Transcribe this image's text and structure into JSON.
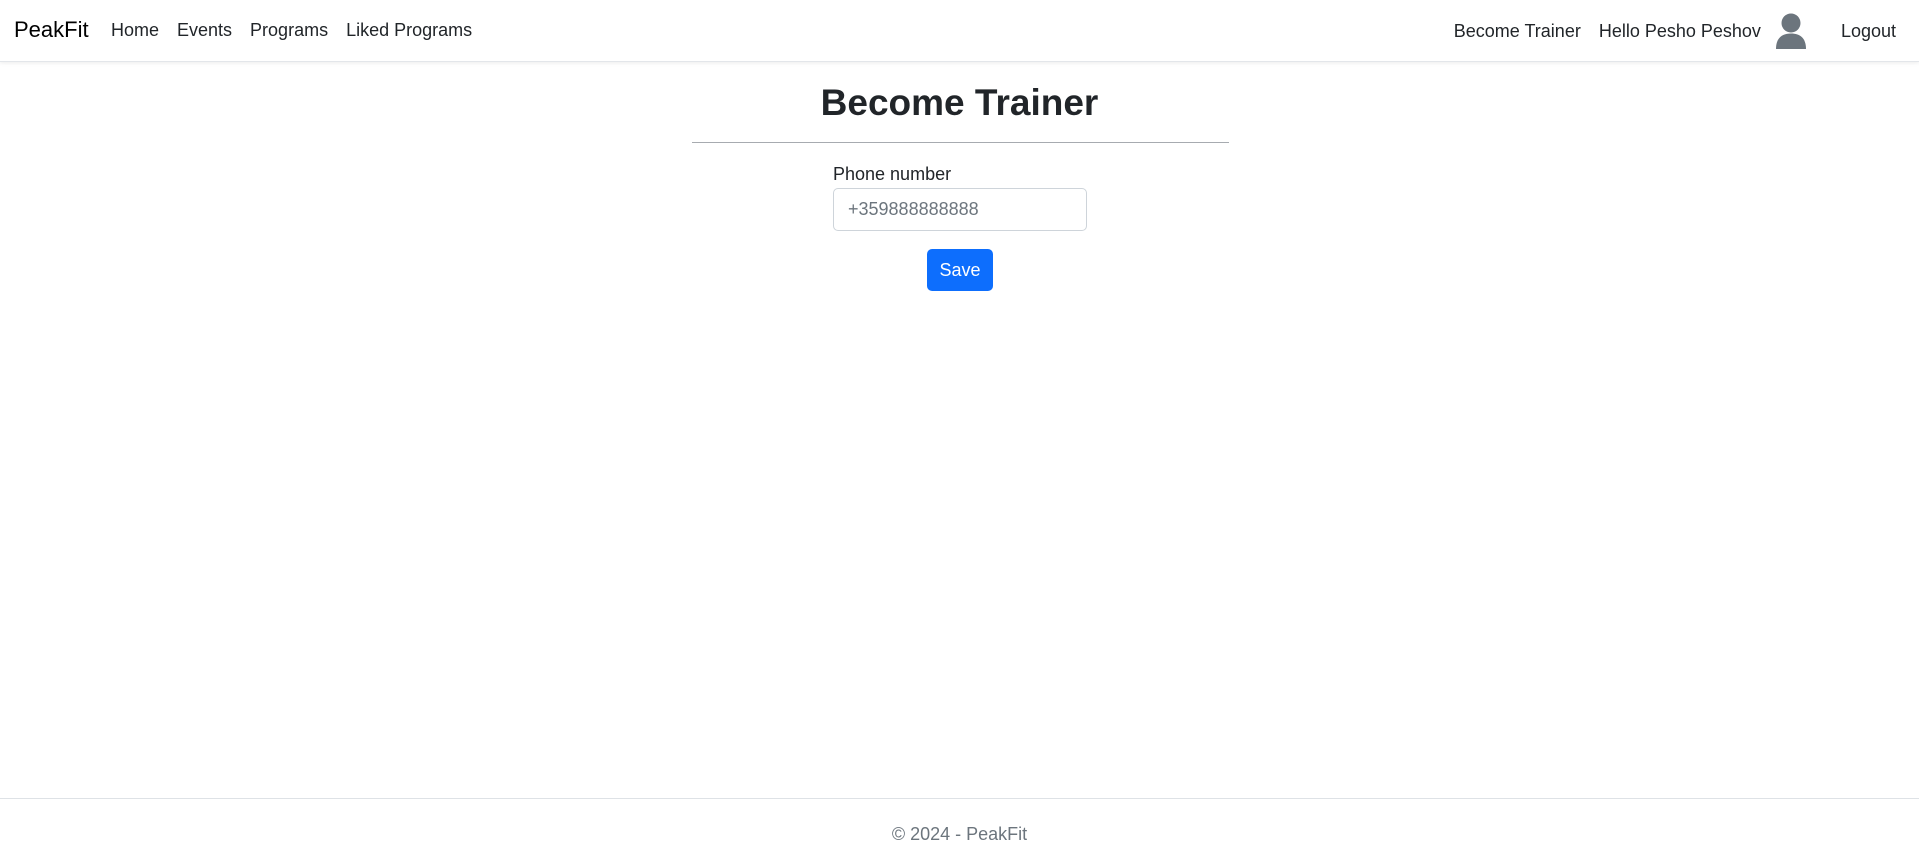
{
  "navbar": {
    "brand": "PeakFit",
    "links": [
      {
        "label": "Home"
      },
      {
        "label": "Events"
      },
      {
        "label": "Programs"
      },
      {
        "label": "Liked Programs"
      }
    ],
    "become_trainer": "Become Trainer",
    "greeting": "Hello Pesho Peshov",
    "avatar_icon": "user-avatar-icon",
    "logout": "Logout"
  },
  "main": {
    "title": "Become Trainer",
    "phone_label": "Phone number",
    "phone_placeholder": "+359888888888",
    "phone_value": "",
    "save_label": "Save"
  },
  "footer": {
    "text": "© 2024 - PeakFit"
  },
  "colors": {
    "primary": "#0d6efd",
    "text": "#212529",
    "muted": "#6c757d",
    "avatar": "#6c757d"
  }
}
